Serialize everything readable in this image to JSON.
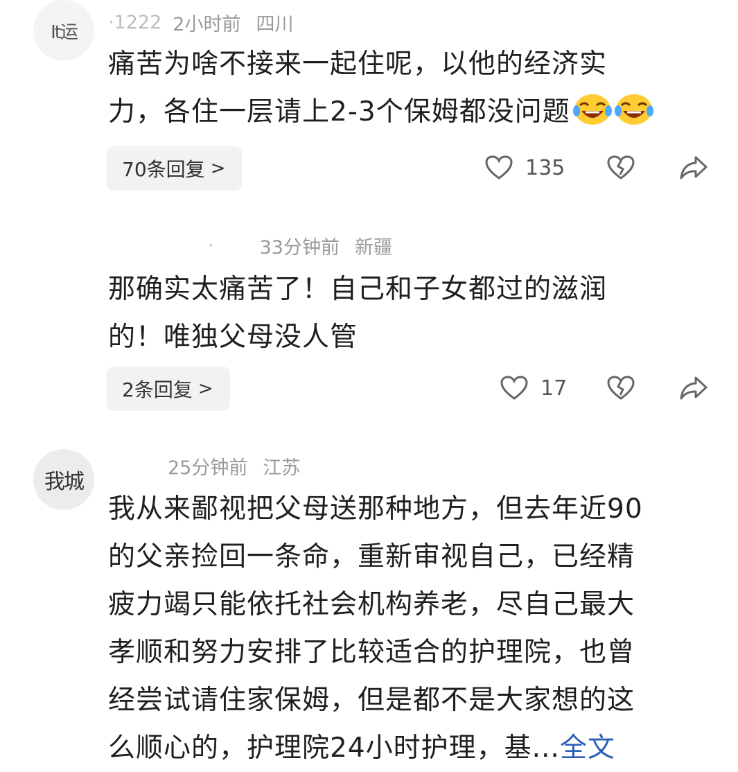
{
  "comments": [
    {
      "avatar_text": "It运",
      "username": "·1222",
      "time": "2小时前",
      "location": "四川",
      "lines": [
        "痛苦为啥不接来一起住呢，以他的经济实",
        "力，各住一层请上2-3个保姆都没问题"
      ],
      "emojis": [
        "laughing-crying-emoji",
        "laughing-crying-emoji"
      ],
      "replies_label": "70条回复",
      "likes": "135"
    },
    {
      "username": "·",
      "time": "33分钟前",
      "location": "新疆",
      "lines": [
        "那确实太痛苦了！自己和子女都过的滋润",
        "的！唯独父母没人管"
      ],
      "replies_label": "2条回复",
      "likes": "17"
    },
    {
      "avatar_text": "我城",
      "username": "",
      "time": "25分钟前",
      "location": "江苏",
      "lines": [
        "我从来鄙视把父母送那种地方，但去年近90",
        "的父亲捡回一条命，重新审视自己，已经精",
        "疲力竭只能依托社会机构养老，尽自己最大",
        "孝顺和努力安排了比较适合的护理院，也曾",
        "经尝试请住家保姆，但是都不是大家想的这",
        "么顺心的，护理院24小时护理，基..."
      ],
      "more_label": "全文"
    }
  ],
  "icons": {
    "like": "heart-outline-icon",
    "dislike": "broken-heart-icon",
    "share": "share-arrow-icon",
    "reply_chevron": "chevron-right-icon"
  },
  "colors": {
    "link": "#2b5fb8",
    "meta": "#9a9a9a",
    "pill_bg": "#f2f2f2"
  }
}
